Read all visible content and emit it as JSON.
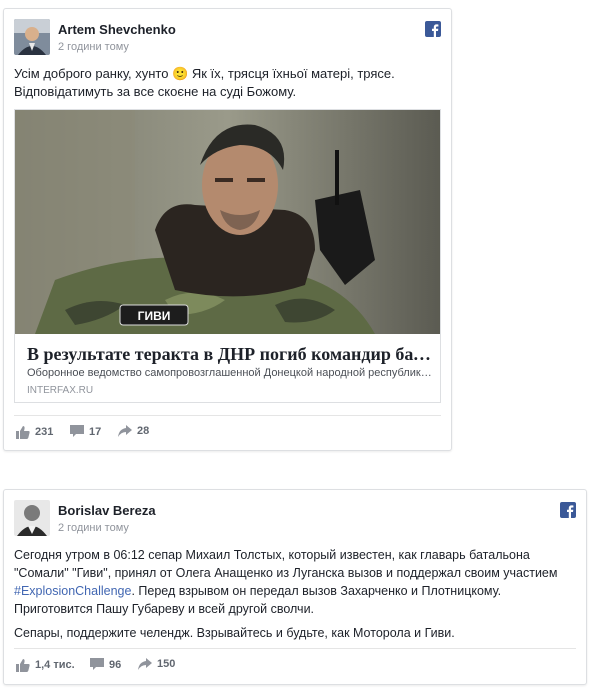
{
  "posts": [
    {
      "author": "Artem Shevchenko",
      "time": "2 години тому",
      "text": "Усім доброго ранку, хунто 🙂 Як їх, трясця їхньої матері, трясе. Відповідатимуть за все скоєне на суді Божому.",
      "link_card": {
        "image_caption": "ГИВИ",
        "title": "В результате теракта в ДНР погиб командир баталь...",
        "description": "Оборонное ведомство самопровозглашенной Донецкой народной республики ...",
        "source": "INTERFAX.RU"
      },
      "stats": {
        "likes": "231",
        "comments": "17",
        "shares": "28"
      }
    },
    {
      "author": "Borislav Bereza",
      "time": "2 години тому",
      "text_lines": {
        "l1": "Сегодня утром в 06:12 сепар Михаил Толстых, который известен, как главарь батальона",
        "l2": "\"Сомали\" \"Гиви\", принял от Олега Анащенко из Луганска вызов и поддержал своим участием",
        "hashtag": "#ExplosionChallenge",
        "l3_rest": ". Перед взрывом он передал вызов Захарченко и Плотницкому.",
        "l4": "Приготовится Пашу Губареву и всей другой сволчи.",
        "p2": "Сепары, поддержите челендж. Взрывайтесь и будьте, как Моторола и Гиви."
      },
      "stats": {
        "likes": "1,4 тис.",
        "comments": "96",
        "shares": "150"
      }
    }
  ],
  "icons": {
    "brand": "facebook-icon",
    "like": "thumbs-up-icon",
    "comment": "comment-icon",
    "share": "share-arrow-icon"
  },
  "colors": {
    "facebook_blue": "#3b5998",
    "link_blue": "#4267b2",
    "meta_grey": "#90949c"
  }
}
